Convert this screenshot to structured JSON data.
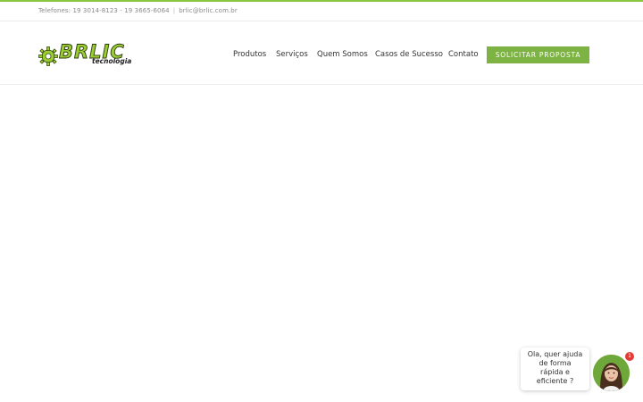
{
  "topbar": {
    "phones": "Telefones: 19 3014-8123 - 19 3665-6064",
    "separator": "|",
    "email": "brlic@brlic.com.br"
  },
  "logo": {
    "name": "BRLIC",
    "tagline": "tecnologia"
  },
  "nav": {
    "items": [
      "Produtos",
      "Serviços",
      "Quem Somos",
      "Casos de Sucesso",
      "Contato"
    ],
    "cta_label": "SOLICITAR PROPOSTA"
  },
  "chat": {
    "lines": [
      "Ola, quer ajuda",
      "de forma",
      "rápida e",
      "eficiente ?"
    ],
    "badge": "1"
  },
  "colors": {
    "accent": "#8cc63f",
    "cta": "#7cb342",
    "badge": "#e53935"
  }
}
